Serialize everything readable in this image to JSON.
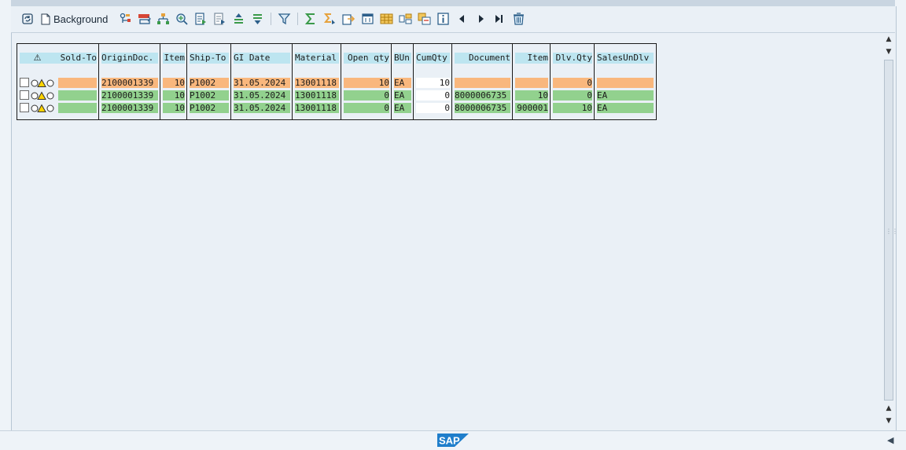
{
  "toolbar": {
    "background_label": "Background",
    "icons": [
      "refresh-icon",
      "document-icon",
      "settings-tree-icon",
      "change-icon",
      "hierarchy-icon",
      "detail-search-icon",
      "select-list-icon",
      "deselect-list-icon",
      "sort-ascending-icon",
      "sort-descending-icon",
      "filter-icon",
      "sum-icon",
      "subtotal-icon",
      "export-icon",
      "print-layout-icon",
      "grid-view-icon",
      "column-layout-icon",
      "change-layout-icon",
      "info-icon",
      "previous-icon",
      "next-icon",
      "last-icon",
      "delete-icon"
    ]
  },
  "table": {
    "headers": {
      "status": "⚠",
      "sold_to": "Sold-To",
      "origin_doc": "OriginDoc.",
      "item": "Item",
      "ship_to": "Ship-To",
      "gi_date": "GI Date",
      "material": "Material",
      "open_qty": "Open qty",
      "bun": "BUn",
      "cum_qty": "CumQty",
      "document": "Document",
      "item2": "Item",
      "dlv_qty": "Dlv.Qty",
      "sales_un_dlv": "SalesUnDlv"
    },
    "rows": [
      {
        "color": "orange",
        "sold_to": "",
        "origin_doc": "2100001339",
        "item": "10",
        "ship_to": "P1002",
        "gi_date": "31.05.2024",
        "material": "13001118",
        "open_qty": "10",
        "bun": "EA",
        "cum_qty": "10",
        "document": "",
        "item2": "",
        "dlv_qty": "0",
        "sales_un_dlv": ""
      },
      {
        "color": "green",
        "sold_to": "",
        "origin_doc": "2100001339",
        "item": "10",
        "ship_to": "P1002",
        "gi_date": "31.05.2024",
        "material": "13001118",
        "open_qty": "0",
        "bun": "EA",
        "cum_qty": "0",
        "document": "8000006735",
        "item2": "10",
        "dlv_qty": "0",
        "sales_un_dlv": "EA"
      },
      {
        "color": "green",
        "sold_to": "",
        "origin_doc": "2100001339",
        "item": "10",
        "ship_to": "P1002",
        "gi_date": "31.05.2024",
        "material": "13001118",
        "open_qty": "0",
        "bun": "EA",
        "cum_qty": "0",
        "document": "8000006735",
        "item2": "900001",
        "dlv_qty": "10",
        "sales_un_dlv": "EA"
      }
    ]
  },
  "colors": {
    "orange": "#f9b77d",
    "green": "#92d18e",
    "header": "#bde5f0",
    "brand": "#1f7ecb"
  },
  "footer": {
    "logo_text": "SAP"
  }
}
